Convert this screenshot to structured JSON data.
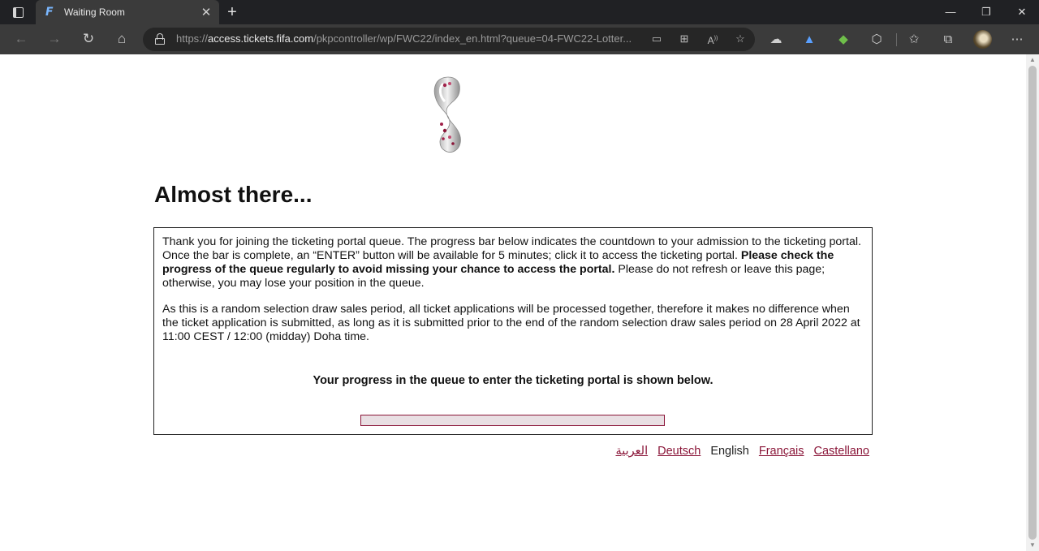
{
  "browser": {
    "tab_title": "Waiting Room",
    "tab_favicon_letter": "F",
    "url_prefix": "https://",
    "url_host": "access.tickets.fifa.com",
    "url_path": "/pkpcontroller/wp/FWC22/index_en.html?queue=04-FWC22-Lotter..."
  },
  "page": {
    "heading": "Almost there...",
    "intro_text": "Thank you for joining the ticketing portal queue. The progress bar below indicates the countdown to your admission to the ticketing portal. Once the bar is complete, an “ENTER” button will be available for 5 minutes; click it to access the ticketing portal.",
    "intro_bold": "Please check the progress of the queue regularly to avoid missing your chance to access the portal.",
    "intro_tail": "Please do not refresh or leave this page; otherwise, you may lose your position in the queue.",
    "random_draw_text": "As this is a random selection draw sales period, all ticket applications will be processed together, therefore it makes no difference when the ticket application is submitted, as long as it is submitted prior to the end of the random selection draw sales period on 28 April 2022 at 11:00 CEST / 12:00 (midday) Doha time.",
    "progress_label": "Your progress in the queue to enter the ticketing portal is shown below.",
    "progress_fraction": 0.0
  },
  "languages": {
    "arabic": "العربية",
    "german": "Deutsch",
    "english": "English",
    "french": "Français",
    "spanish": "Castellano"
  },
  "colors": {
    "accent": "#8a1538",
    "progress_track": "#e9dfe3",
    "chrome_dark": "#202124",
    "toolbar": "#3b3b3b"
  },
  "icons": [
    "tab-actions-icon",
    "close-icon",
    "new-tab-icon",
    "minimize-icon",
    "restore-icon",
    "window-close-icon",
    "back-icon",
    "forward-icon",
    "refresh-icon",
    "home-icon",
    "lock-icon",
    "app-available-icon",
    "qr-code-icon",
    "read-aloud-icon",
    "add-favorite-icon",
    "extension-icon",
    "favorites-icon",
    "collections-icon",
    "profile-avatar",
    "more-icon",
    "trophy-logo"
  ]
}
